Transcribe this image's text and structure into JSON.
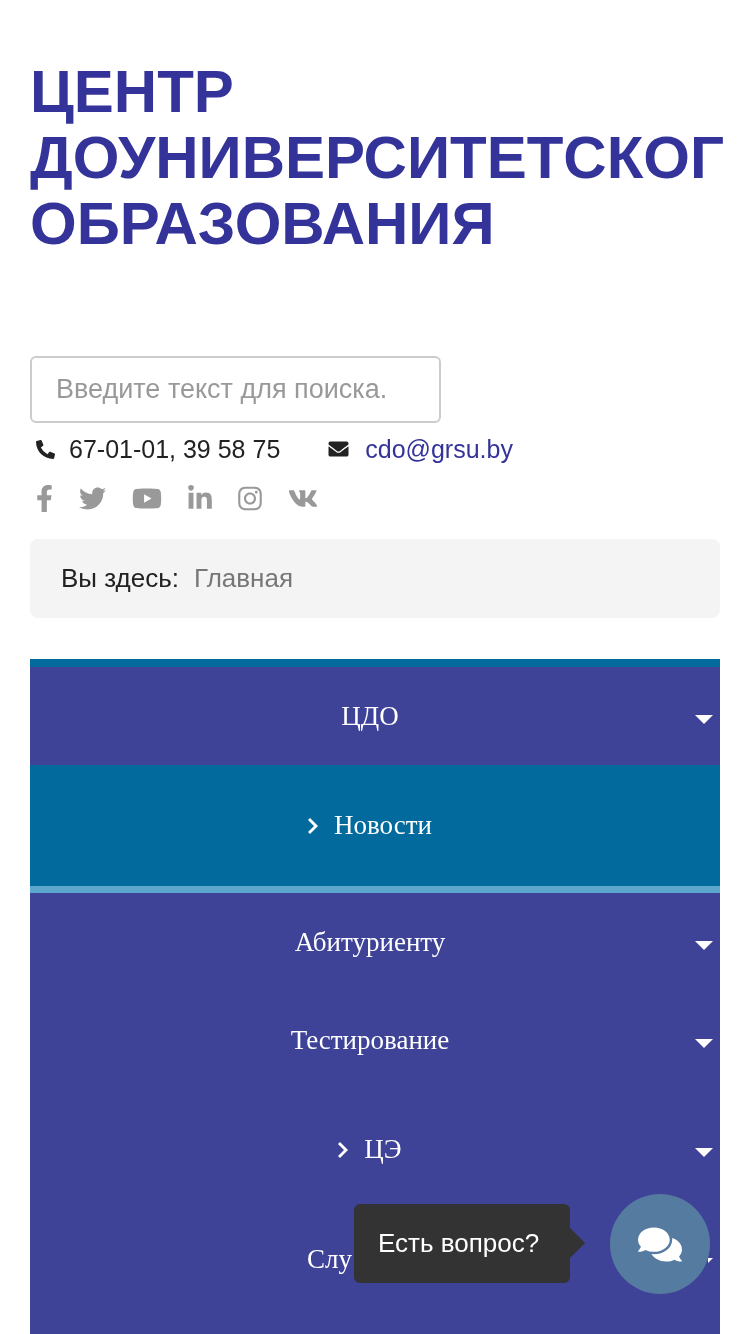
{
  "header": {
    "title_lines": [
      "ЦЕНТР",
      "ДОУНИВЕРСИТЕТСКОГ",
      "ОБРАЗОВАНИЯ"
    ]
  },
  "search": {
    "placeholder": "Введите текст для поиска."
  },
  "contacts": {
    "phone": "67-01-01, 39 58 75",
    "email": "cdo@grsu.by"
  },
  "breadcrumb": {
    "label": "Вы здесь:",
    "current": "Главная"
  },
  "menu": {
    "items": [
      {
        "label": "ЦДО",
        "has_submenu": true,
        "selected": false,
        "cut_off": false,
        "children": [
          {
            "label": "Новости",
            "has_submenu": false,
            "selected": true,
            "cut_off": false
          }
        ]
      },
      {
        "label": "Абитуриенту",
        "has_submenu": true,
        "selected": false,
        "cut_off": false
      },
      {
        "label": "Тестирование",
        "has_submenu": true,
        "selected": false,
        "cut_off": false,
        "children": [
          {
            "label": "ЦЭ",
            "has_submenu": true,
            "selected": false,
            "cut_off": false
          }
        ]
      },
      {
        "label": "Слу",
        "has_submenu": true,
        "selected": false,
        "cut_off": true
      }
    ]
  },
  "chat": {
    "tooltip": "Есть вопрос?"
  }
}
